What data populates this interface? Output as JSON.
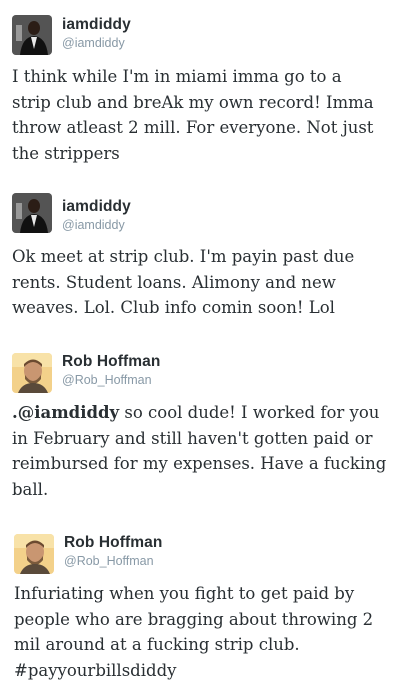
{
  "tweets": [
    {
      "name": "iamdiddy",
      "handle": "@iamdiddy",
      "avatar_icon": "diddy-avatar-icon",
      "text_lines": [
        "I think while I'm in miami imma go to a",
        "strip club and breAk my own record! Imma",
        "throw atleast 2 mill. For everyone. Not just",
        "the strippers"
      ]
    },
    {
      "name": "iamdiddy",
      "handle": "@iamdiddy",
      "avatar_icon": "diddy-avatar-icon",
      "text_lines": [
        "Ok meet at strip club. I'm payin past due",
        "rents. Student loans. Alimony and new",
        "weaves. Lol. Club info comin soon! Lol"
      ]
    },
    {
      "name": "Rob Hoffman",
      "handle": "@Rob_Hoffman",
      "avatar_icon": "rob-hoffman-avatar-icon",
      "mention": ".@iamdiddy",
      "text_lines": [
        " so cool dude! I worked for you",
        "in February and still haven't gotten paid or",
        "reimbursed for my expenses. Have a fucking",
        "ball."
      ]
    },
    {
      "name": "Rob Hoffman",
      "handle": "@Rob_Hoffman",
      "avatar_icon": "rob-hoffman-avatar-icon",
      "text_lines": [
        "Infuriating when you fight to get paid by",
        "people who are bragging about throwing 2",
        "mil around at a fucking strip club.",
        "#payyourbillsdiddy"
      ]
    }
  ],
  "colors": {
    "text": "#292f33",
    "handle": "#8899a6",
    "background": "#ffffff"
  }
}
